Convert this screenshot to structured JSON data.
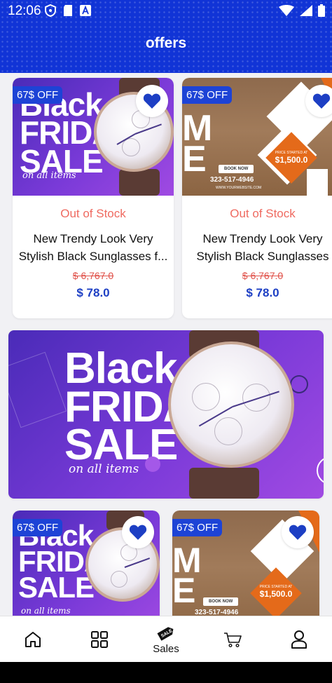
{
  "status_bar": {
    "time": "12:06"
  },
  "header": {
    "title": "offers"
  },
  "products_row1": [
    {
      "badge": "67$ OFF",
      "stock": "Out of Stock",
      "name_line1": "New Trendy Look Very",
      "name_line2": "Stylish Black Sunglasses f...",
      "old_price": "$ 6,767.0",
      "new_price": "$ 78.0",
      "art": {
        "line1": "Black",
        "line2": "FRIDAY",
        "line3": "SALE",
        "script": "on all items"
      }
    },
    {
      "badge": "67$ OFF",
      "stock": "Out of Stock",
      "name_line1": "New Trendy Look Very",
      "name_line2": "Stylish Black Sunglasses",
      "old_price": "$ 6,767.0",
      "new_price": "$ 78.0",
      "art": {
        "price_label": "PRICE STARTED AT",
        "price": "$1,500.0",
        "book": "BOOK NOW",
        "phone": "323-517-4946",
        "site": "WWW.YOURWEBSITE.COM"
      }
    }
  ],
  "banner": {
    "line1": "Black",
    "line2": "FRIDAY",
    "line3": "SALE",
    "script": "on all items"
  },
  "products_row2": [
    {
      "badge": "67$ OFF",
      "art": {
        "line1": "Black",
        "line2": "FRIDAY",
        "line3": "SALE",
        "script": "on all items"
      }
    },
    {
      "badge": "67$ OFF",
      "art": {
        "price_label": "PRICE STARTED AT",
        "price": "$1,500.0",
        "book": "BOOK NOW",
        "phone": "323-517-4946"
      }
    }
  ],
  "bottom_nav": [
    {
      "icon": "home-icon",
      "label": ""
    },
    {
      "icon": "grid-icon",
      "label": ""
    },
    {
      "icon": "sale-tag-icon",
      "label": "Sales",
      "tag_text": "SALE"
    },
    {
      "icon": "cart-icon",
      "label": ""
    },
    {
      "icon": "profile-icon",
      "label": ""
    }
  ],
  "colors": {
    "primary": "#1134d6",
    "badge": "#1d43d6",
    "stock": "#ef6a60",
    "price": "#1d3fc4"
  }
}
